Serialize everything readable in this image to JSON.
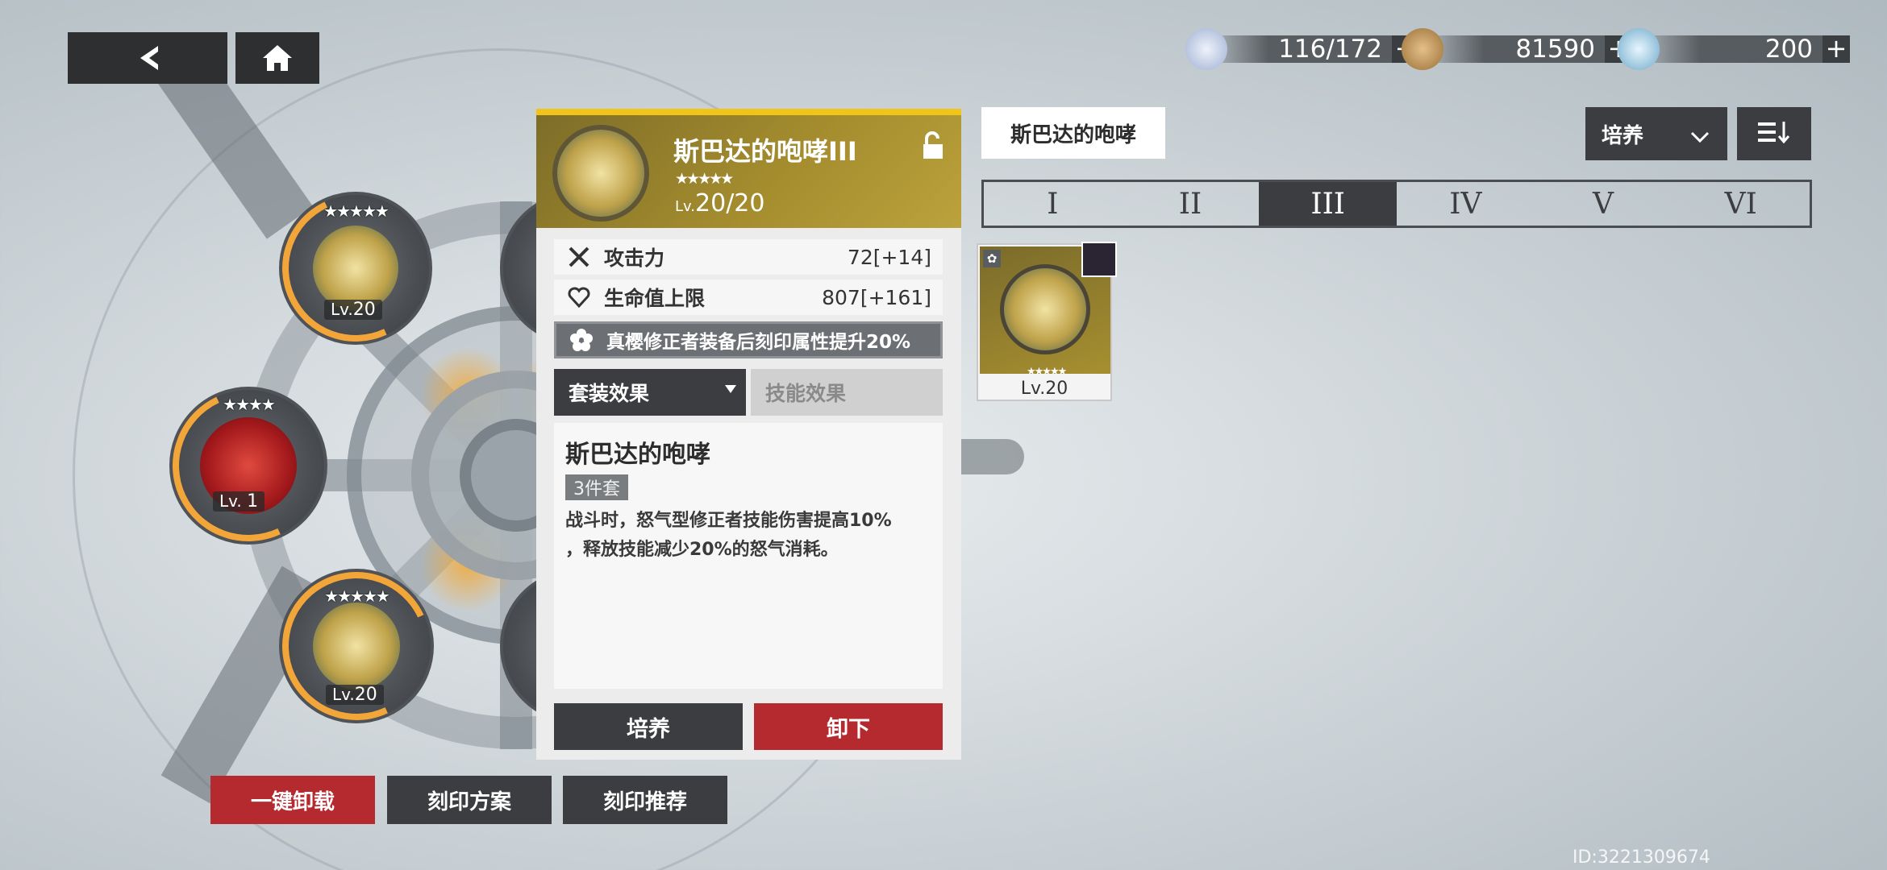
{
  "nav": {
    "back_icon": "back-arrow-icon",
    "home_icon": "home-icon"
  },
  "currencies": [
    {
      "icon": "stamina-icon",
      "value": "116/172",
      "color": "#c7d3ea"
    },
    {
      "icon": "coin-icon",
      "value": "81590",
      "color": "#c99a5e"
    },
    {
      "icon": "crystal-icon",
      "value": "200",
      "color": "#a9d8ef"
    }
  ],
  "slots": {
    "top_left": {
      "stars": "★★★★★",
      "level_prefix": "Lv.",
      "level": "20"
    },
    "middle_left": {
      "stars": "★★★★",
      "level_prefix": "Lv.",
      "level": "1"
    },
    "bottom_left": {
      "stars": "★★★★★",
      "level_prefix": "Lv.",
      "level": "20"
    }
  },
  "panel": {
    "title": "斯巴达的咆哮III",
    "stars": "★★★★★",
    "level_prefix": "Lv.",
    "level": "20/20",
    "stats": [
      {
        "name": "攻击力",
        "value": "72[+14]",
        "icon": "attack-swords-icon"
      },
      {
        "name": "生命值上限",
        "value": "807[+161]",
        "icon": "heart-icon"
      }
    ],
    "bonus_text": "真樱修正者装备后刻印属性提升20%",
    "tabs": {
      "set_effect": "套装效果",
      "skill_effect": "技能效果"
    },
    "set_name": "斯巴达的咆哮",
    "set_count": "3件套",
    "description_line1": "战斗时，怒气型修正者技能伤害提高10%",
    "description_line2": "，释放技能减少20%的怒气消耗。",
    "btn_upgrade": "培养",
    "btn_unequip": "卸下"
  },
  "right": {
    "set_filter": "斯巴达的咆哮",
    "sort_label": "培养",
    "roman_tabs": [
      "I",
      "II",
      "III",
      "IV",
      "V",
      "VI"
    ],
    "active_tab": 2,
    "card": {
      "level": "Lv.20",
      "stars": "★★★★★"
    }
  },
  "bottom": {
    "unequip_all": "一键卸载",
    "plan": "刻印方案",
    "recommend": "刻印推荐"
  },
  "uid": "ID:3221309674",
  "colors": {
    "accent_gold": "#f0c419",
    "danger_red": "#b52a2f",
    "dark": "#3b3d40"
  }
}
